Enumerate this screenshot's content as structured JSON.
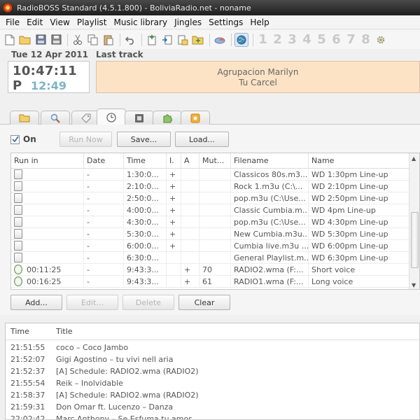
{
  "window": {
    "title": "RadioBOSS Standard (4.5.1.800) - BoliviaRadio.net - noname"
  },
  "menu": [
    "File",
    "Edit",
    "View",
    "Playlist",
    "Music library",
    "Jingles",
    "Settings",
    "Help"
  ],
  "toolbar": {
    "icons": [
      "new-file-icon",
      "open-folder-icon",
      "save-icon",
      "save-as-icon",
      "cut-icon",
      "copy-icon",
      "paste-icon",
      "undo-icon",
      "insert-track-icon",
      "insert-before-icon",
      "insert-after-icon",
      "insert-folder-icon",
      "chart-icon",
      "globe-icon"
    ],
    "numbers": [
      "1",
      "2",
      "3",
      "4",
      "5",
      "6",
      "7",
      "8"
    ]
  },
  "clock": {
    "date": "Tue 12 Apr 2011",
    "time": "10:47:11 P",
    "remaining": "12:49"
  },
  "last_track": {
    "label": "Last track",
    "artist": "Agrupacion Marilyn",
    "title": "Tu Carcel"
  },
  "tabs": [
    "folder-icon",
    "search-icon",
    "tag-icon",
    "clock-icon",
    "film-icon",
    "puzzle-icon",
    "settings-box-icon"
  ],
  "scheduler": {
    "on_label": "On",
    "on_checked": true,
    "run_now": "Run Now",
    "save": "Save...",
    "load": "Load...",
    "columns": [
      "Run in",
      "Date",
      "Time",
      "I.",
      "A",
      "Mut...",
      "Filename",
      "Name"
    ],
    "rows": [
      {
        "run_in": "",
        "date": "-",
        "time": "1:30:0...",
        "i": "+",
        "a": "",
        "mut": "",
        "filename": "Classicos 80s.m3...",
        "name": "WD 1:30pm Line-up",
        "timed": false
      },
      {
        "run_in": "",
        "date": "-",
        "time": "2:10:0...",
        "i": "+",
        "a": "",
        "mut": "",
        "filename": "Rock 1.m3u  (C:\\...",
        "name": "WD 2:10pm Line-up",
        "timed": false
      },
      {
        "run_in": "",
        "date": "-",
        "time": "2:50:0...",
        "i": "+",
        "a": "",
        "mut": "",
        "filename": "pop.m3u  (C:\\Use...",
        "name": "WD 2:50pm Line-up",
        "timed": false
      },
      {
        "run_in": "",
        "date": "-",
        "time": "4:00:0...",
        "i": "+",
        "a": "",
        "mut": "",
        "filename": "Classic Cumbia.m...",
        "name": "WD 4pm Line-up",
        "timed": false
      },
      {
        "run_in": "",
        "date": "-",
        "time": "4:30:0...",
        "i": "+",
        "a": "",
        "mut": "",
        "filename": "pop.m3u  (C:\\Use...",
        "name": "WD 4:30pm Line-up",
        "timed": false
      },
      {
        "run_in": "",
        "date": "-",
        "time": "5:30:0...",
        "i": "+",
        "a": "",
        "mut": "",
        "filename": "New Cumbia.m3u...",
        "name": "WD 5:30pm Line-up",
        "timed": false
      },
      {
        "run_in": "",
        "date": "-",
        "time": "6:00:0...",
        "i": "+",
        "a": "",
        "mut": "",
        "filename": "Cumbia live.m3u ...",
        "name": "WD 6:00pm Line-up",
        "timed": false
      },
      {
        "run_in": "",
        "date": "-",
        "time": "6:30:0...",
        "i": "",
        "a": "",
        "mut": "",
        "filename": "General Playlist.m...",
        "name": "WD 6:30pm Line-up",
        "timed": false
      },
      {
        "run_in": "00:11:25",
        "date": "-",
        "time": "9:43:3...",
        "i": "",
        "a": "+",
        "mut": "70",
        "filename": "RADIO2.wma  (F:...",
        "name": "Short voice",
        "timed": true
      },
      {
        "run_in": "00:16:25",
        "date": "-",
        "time": "9:43:3...",
        "i": "",
        "a": "+",
        "mut": "61",
        "filename": "RADIO1.wma  (F:...",
        "name": "Long voice",
        "timed": true
      }
    ],
    "add": "Add...",
    "edit": "Edit...",
    "delete": "Delete",
    "clear": "Clear"
  },
  "log": {
    "columns": [
      "Time",
      "Title"
    ],
    "rows": [
      {
        "time": "21:51:55",
        "title": "coco – Coco Jambo"
      },
      {
        "time": "21:52:07",
        "title": "Gigi Agostino – tu vivi nell aria"
      },
      {
        "time": "21:52:37",
        "title": "[A] Schedule: RADIO2.wma (RADIO2)"
      },
      {
        "time": "21:55:54",
        "title": "Reik – Inolvidable"
      },
      {
        "time": "21:58:37",
        "title": "[A] Schedule: RADIO2.wma (RADIO2)"
      },
      {
        "time": "21:59:31",
        "title": "Don Omar ft. Lucenzo – Danza"
      },
      {
        "time": "22:02:42",
        "title": "Marc Anthony – Se Esfuma tu amor"
      }
    ]
  },
  "colors": {
    "last_track_bg": "#fde3c6",
    "clock_remaining": "#7fb3c6",
    "title_bar": "#2a2a2a"
  }
}
